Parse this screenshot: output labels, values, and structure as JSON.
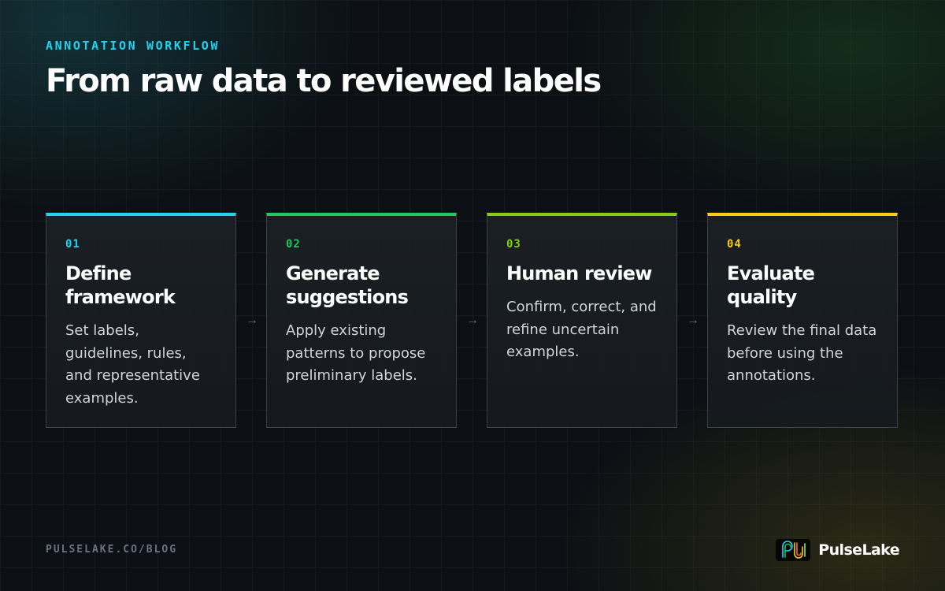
{
  "header": {
    "eyebrow": "ANNOTATION WORKFLOW",
    "title": "From raw data to reviewed labels"
  },
  "steps": [
    {
      "number": "01",
      "title": "Define framework",
      "body": "Set labels, guidelines, rules, and representative examples.",
      "accent": "#22d3ee"
    },
    {
      "number": "02",
      "title": "Generate suggestions",
      "body": "Apply existing patterns to propose preliminary labels.",
      "accent": "#22c55e"
    },
    {
      "number": "03",
      "title": "Human review",
      "body": "Confirm, correct, and refine uncertain examples.",
      "accent": "#84cc16"
    },
    {
      "number": "04",
      "title": "Evaluate quality",
      "body": "Review the final data before using the annotations.",
      "accent": "#facc15"
    }
  ],
  "arrow_glyph": "→",
  "footer": {
    "url": "PULSELAKE.CO/BLOG",
    "brand": "PulseLake",
    "logo_icon": "pulselake-logo-icon"
  }
}
